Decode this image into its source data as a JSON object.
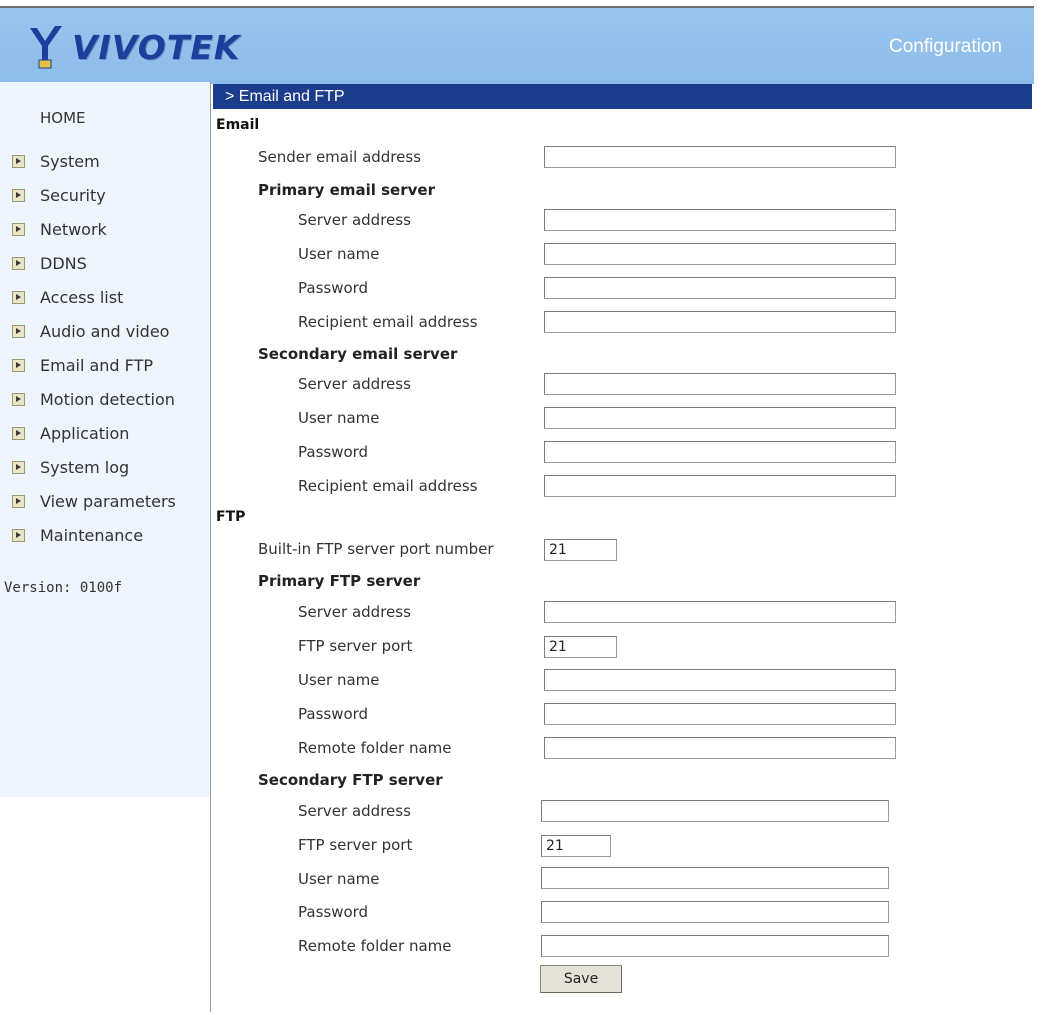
{
  "header": {
    "logo_text": "VIVOTEK",
    "title": "Configuration"
  },
  "sidebar": {
    "home": "HOME",
    "items": [
      {
        "label": "System"
      },
      {
        "label": "Security"
      },
      {
        "label": "Network"
      },
      {
        "label": "DDNS"
      },
      {
        "label": "Access list"
      },
      {
        "label": "Audio and video"
      },
      {
        "label": "Email and FTP"
      },
      {
        "label": "Motion detection"
      },
      {
        "label": "Application"
      },
      {
        "label": "System log"
      },
      {
        "label": "View parameters"
      },
      {
        "label": "Maintenance"
      }
    ],
    "version": "Version: 0100f"
  },
  "section": {
    "title": "> Email and FTP"
  },
  "email": {
    "heading": "Email",
    "sender_label": "Sender email address",
    "sender_value": "",
    "primary": {
      "heading": "Primary email server",
      "server_label": "Server address",
      "server_value": "",
      "user_label": "User name",
      "user_value": "",
      "password_label": "Password",
      "password_value": "",
      "recipient_label": "Recipient email address",
      "recipient_value": ""
    },
    "secondary": {
      "heading": "Secondary email server",
      "server_label": "Server address",
      "server_value": "",
      "user_label": "User name",
      "user_value": "",
      "password_label": "Password",
      "password_value": "",
      "recipient_label": "Recipient email address",
      "recipient_value": ""
    }
  },
  "ftp": {
    "heading": "FTP",
    "builtin_port_label": "Built-in FTP server port number",
    "builtin_port_value": "21",
    "primary": {
      "heading": "Primary FTP server",
      "server_label": "Server address",
      "server_value": "",
      "port_label": "FTP server port",
      "port_value": "21",
      "user_label": "User name",
      "user_value": "",
      "password_label": "Password",
      "password_value": "",
      "folder_label": "Remote folder name",
      "folder_value": ""
    },
    "secondary": {
      "heading": "Secondary FTP server",
      "server_label": "Server address",
      "server_value": "",
      "port_label": "FTP server port",
      "port_value": "21",
      "user_label": "User name",
      "user_value": "",
      "password_label": "Password",
      "password_value": "",
      "folder_label": "Remote folder name",
      "folder_value": ""
    }
  },
  "actions": {
    "save_label": "Save"
  },
  "colors": {
    "header_bg": "#8dbce8",
    "section_bar": "#1c3c8c",
    "sidebar_bg": "#eef5fc",
    "logo_blue": "#1d3f9c"
  }
}
